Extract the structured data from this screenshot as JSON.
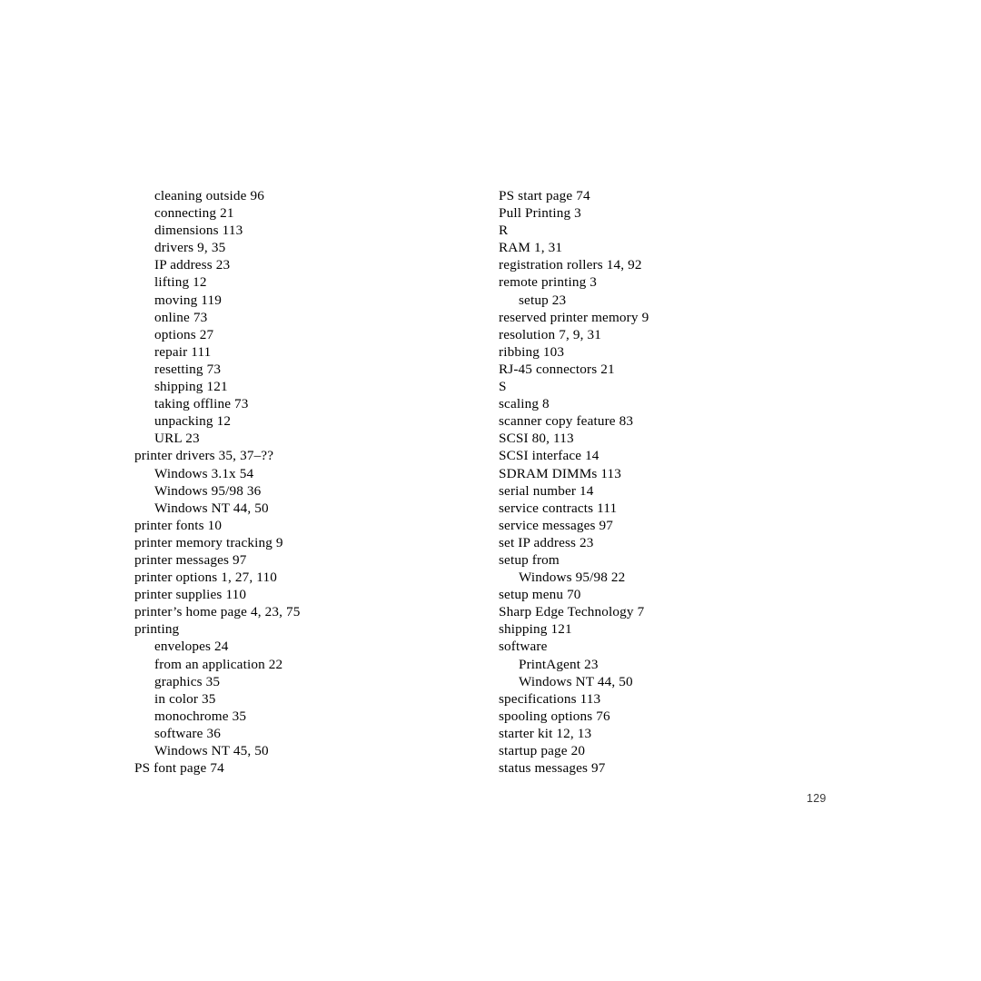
{
  "page": {
    "folio": "129",
    "kind": "index"
  },
  "columns": [
    {
      "name": "left-column",
      "entries": [
        {
          "text": "cleaning outside 96",
          "level": 1,
          "type": "entry"
        },
        {
          "text": "connecting 21",
          "level": 1,
          "type": "entry"
        },
        {
          "text": "dimensions 113",
          "level": 1,
          "type": "entry"
        },
        {
          "text": "drivers 9, 35",
          "level": 1,
          "type": "entry"
        },
        {
          "text": "IP address 23",
          "level": 1,
          "type": "entry"
        },
        {
          "text": "lifting 12",
          "level": 1,
          "type": "entry"
        },
        {
          "text": "moving 119",
          "level": 1,
          "type": "entry"
        },
        {
          "text": "online 73",
          "level": 1,
          "type": "entry"
        },
        {
          "text": "options 27",
          "level": 1,
          "type": "entry"
        },
        {
          "text": "repair 111",
          "level": 1,
          "type": "entry"
        },
        {
          "text": "resetting 73",
          "level": 1,
          "type": "entry"
        },
        {
          "text": "shipping 121",
          "level": 1,
          "type": "entry"
        },
        {
          "text": "taking offline 73",
          "level": 1,
          "type": "entry"
        },
        {
          "text": "unpacking 12",
          "level": 1,
          "type": "entry"
        },
        {
          "text": "URL 23",
          "level": 1,
          "type": "entry"
        },
        {
          "text": "printer drivers 35, 37–??",
          "level": 0,
          "type": "entry"
        },
        {
          "text": "Windows 3.1x 54",
          "level": 1,
          "type": "entry"
        },
        {
          "text": "Windows 95/98 36",
          "level": 1,
          "type": "entry"
        },
        {
          "text": "Windows NT 44, 50",
          "level": 1,
          "type": "entry"
        },
        {
          "text": "printer fonts 10",
          "level": 0,
          "type": "entry"
        },
        {
          "text": "printer memory tracking 9",
          "level": 0,
          "type": "entry"
        },
        {
          "text": "printer messages 97",
          "level": 0,
          "type": "entry"
        },
        {
          "text": "printer options 1, 27, 110",
          "level": 0,
          "type": "entry"
        },
        {
          "text": "printer supplies 110",
          "level": 0,
          "type": "entry"
        },
        {
          "text": "printer’s home page 4, 23, 75",
          "level": 0,
          "type": "entry"
        },
        {
          "text": "printing",
          "level": 0,
          "type": "entry"
        },
        {
          "text": "envelopes 24",
          "level": 1,
          "type": "entry"
        },
        {
          "text": "from an application 22",
          "level": 1,
          "type": "entry"
        },
        {
          "text": "graphics 35",
          "level": 1,
          "type": "entry"
        },
        {
          "text": "in color 35",
          "level": 1,
          "type": "entry"
        },
        {
          "text": "monochrome 35",
          "level": 1,
          "type": "entry"
        },
        {
          "text": "software 36",
          "level": 1,
          "type": "entry"
        },
        {
          "text": "Windows NT 45, 50",
          "level": 1,
          "type": "entry"
        },
        {
          "text": "PS font page 74",
          "level": 0,
          "type": "entry"
        }
      ]
    },
    {
      "name": "right-column",
      "entries": [
        {
          "text": "PS start page 74",
          "level": 0,
          "type": "entry"
        },
        {
          "text": "Pull Printing 3",
          "level": 0,
          "type": "entry"
        },
        {
          "text": "R",
          "level": 0,
          "type": "section-letter"
        },
        {
          "text": "RAM 1, 31",
          "level": 0,
          "type": "entry"
        },
        {
          "text": "registration rollers 14, 92",
          "level": 0,
          "type": "entry"
        },
        {
          "text": "remote printing 3",
          "level": 0,
          "type": "entry"
        },
        {
          "text": "setup 23",
          "level": 1,
          "type": "entry"
        },
        {
          "text": "reserved printer memory 9",
          "level": 0,
          "type": "entry"
        },
        {
          "text": "resolution 7, 9, 31",
          "level": 0,
          "type": "entry"
        },
        {
          "text": "ribbing 103",
          "level": 0,
          "type": "entry"
        },
        {
          "text": "RJ-45 connectors 21",
          "level": 0,
          "type": "entry"
        },
        {
          "text": "S",
          "level": 0,
          "type": "section-letter"
        },
        {
          "text": "scaling 8",
          "level": 0,
          "type": "entry"
        },
        {
          "text": "scanner copy feature 83",
          "level": 0,
          "type": "entry"
        },
        {
          "text": "SCSI 80, 113",
          "level": 0,
          "type": "entry"
        },
        {
          "text": "SCSI interface 14",
          "level": 0,
          "type": "entry"
        },
        {
          "text": "SDRAM DIMMs 113",
          "level": 0,
          "type": "entry"
        },
        {
          "text": "serial number 14",
          "level": 0,
          "type": "entry"
        },
        {
          "text": "service contracts 111",
          "level": 0,
          "type": "entry"
        },
        {
          "text": "service messages 97",
          "level": 0,
          "type": "entry"
        },
        {
          "text": "set IP address 23",
          "level": 0,
          "type": "entry"
        },
        {
          "text": "setup from",
          "level": 0,
          "type": "entry"
        },
        {
          "text": "Windows 95/98 22",
          "level": 1,
          "type": "entry"
        },
        {
          "text": "setup menu 70",
          "level": 0,
          "type": "entry"
        },
        {
          "text": "Sharp Edge Technology 7",
          "level": 0,
          "type": "entry"
        },
        {
          "text": "shipping 121",
          "level": 0,
          "type": "entry"
        },
        {
          "text": "software",
          "level": 0,
          "type": "entry"
        },
        {
          "text": "PrintAgent 23",
          "level": 1,
          "type": "entry"
        },
        {
          "text": "Windows NT 44, 50",
          "level": 1,
          "type": "entry"
        },
        {
          "text": "specifications 113",
          "level": 0,
          "type": "entry"
        },
        {
          "text": "spooling options 76",
          "level": 0,
          "type": "entry"
        },
        {
          "text": "starter kit 12, 13",
          "level": 0,
          "type": "entry"
        },
        {
          "text": "startup page 20",
          "level": 0,
          "type": "entry"
        },
        {
          "text": "status messages 97",
          "level": 0,
          "type": "entry"
        }
      ]
    }
  ]
}
